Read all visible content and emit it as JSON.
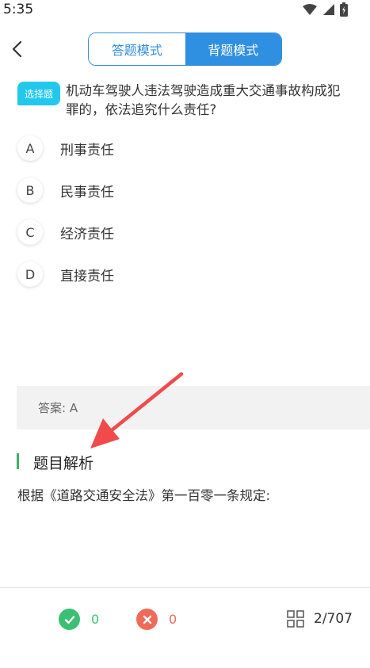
{
  "status_bar": {
    "time": "5:35"
  },
  "header": {
    "modes": [
      "答题模式",
      "背题模式"
    ],
    "active_mode": "背题模式"
  },
  "question": {
    "type_tag": "选择题",
    "line1": "机动车驾驶人违法驾驶造成重大交通事故构成犯",
    "line2": "罪的，依法追究什么责任?",
    "options": [
      {
        "letter": "A",
        "text": "刑事责任"
      },
      {
        "letter": "B",
        "text": "民事责任"
      },
      {
        "letter": "C",
        "text": "经济责任"
      },
      {
        "letter": "D",
        "text": "直接责任"
      }
    ]
  },
  "answer": {
    "text": "答案: A"
  },
  "analysis": {
    "title": "题目解析",
    "text": "根据《道路交通安全法》第一百零一条规定:"
  },
  "footer": {
    "correct_count": "0",
    "wrong_count": "0",
    "progress": "2/707"
  },
  "colors": {
    "accent": "#2f8fe0",
    "tag": "#22c8ec",
    "correct": "#3cbf74",
    "wrong": "#f06a5a",
    "annotation_arrow": "#f04a4a"
  }
}
